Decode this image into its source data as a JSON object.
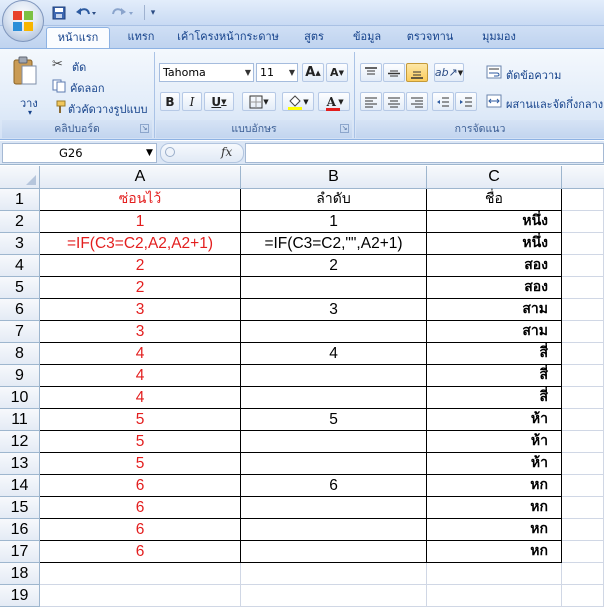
{
  "titlebar": {
    "quick_access": {
      "save_icon": "floppy-disk-icon",
      "undo_icon": "undo-icon",
      "redo_icon": "redo-icon"
    }
  },
  "tabs": [
    {
      "label": "หน้าแรก",
      "active": true
    },
    {
      "label": "แทรก"
    },
    {
      "label": "เค้าโครงหน้ากระดาษ"
    },
    {
      "label": "สูตร"
    },
    {
      "label": "ข้อมูล"
    },
    {
      "label": "ตรวจทาน"
    },
    {
      "label": "มุมมอง"
    }
  ],
  "ribbon": {
    "clipboard": {
      "paste_label": "วาง",
      "cut_label": "ตัด",
      "copy_label": "คัดลอก",
      "format_painter_label": "ตัวคัดวางรูปแบบ",
      "group_label": "คลิปบอร์ด"
    },
    "font": {
      "font_name": "Tahoma",
      "font_size": "11",
      "bold": "B",
      "italic": "I",
      "underline": "U",
      "grow_font": "A",
      "shrink_font": "A",
      "font_color_letter": "A",
      "group_label": "แบบอักษร"
    },
    "alignment": {
      "wrap_text_label": "ตัดข้อความ",
      "merge_center_label": "ผสานและจัดกึ่งกลาง",
      "group_label": "การจัดแนว"
    }
  },
  "formula_bar": {
    "name_box": "G26",
    "fx_label": "fx",
    "formula": ""
  },
  "colors": {
    "red_text": "#e31e1e",
    "ribbon_blue": "#15428b"
  },
  "sheet": {
    "columns": [
      "A",
      "B",
      "C"
    ],
    "row_numbers": [
      "1",
      "2",
      "3",
      "4",
      "5",
      "6",
      "7",
      "8",
      "9",
      "10",
      "11",
      "12",
      "13",
      "14",
      "15",
      "16",
      "17",
      "18",
      "19"
    ],
    "rows": [
      [
        "ซ่อนไว้",
        "ลำดับ",
        "ชื่อ"
      ],
      [
        "1",
        "1",
        "หนึ่ง"
      ],
      [
        "=IF(C3=C2,A2,A2+1)",
        "=IF(C3=C2,\"\",A2+1)",
        "หนึ่ง"
      ],
      [
        "2",
        "2",
        "สอง"
      ],
      [
        "2",
        "",
        "สอง"
      ],
      [
        "3",
        "3",
        "สาม"
      ],
      [
        "3",
        "",
        "สาม"
      ],
      [
        "4",
        "4",
        "สี่"
      ],
      [
        "4",
        "",
        "สี่"
      ],
      [
        "4",
        "",
        "สี่"
      ],
      [
        "5",
        "5",
        "ห้า"
      ],
      [
        "5",
        "",
        "ห้า"
      ],
      [
        "5",
        "",
        "ห้า"
      ],
      [
        "6",
        "6",
        "หก"
      ],
      [
        "6",
        "",
        "หก"
      ],
      [
        "6",
        "",
        "หก"
      ],
      [
        "6",
        "",
        "หก"
      ],
      [
        "",
        "",
        ""
      ],
      [
        "",
        "",
        ""
      ]
    ]
  }
}
